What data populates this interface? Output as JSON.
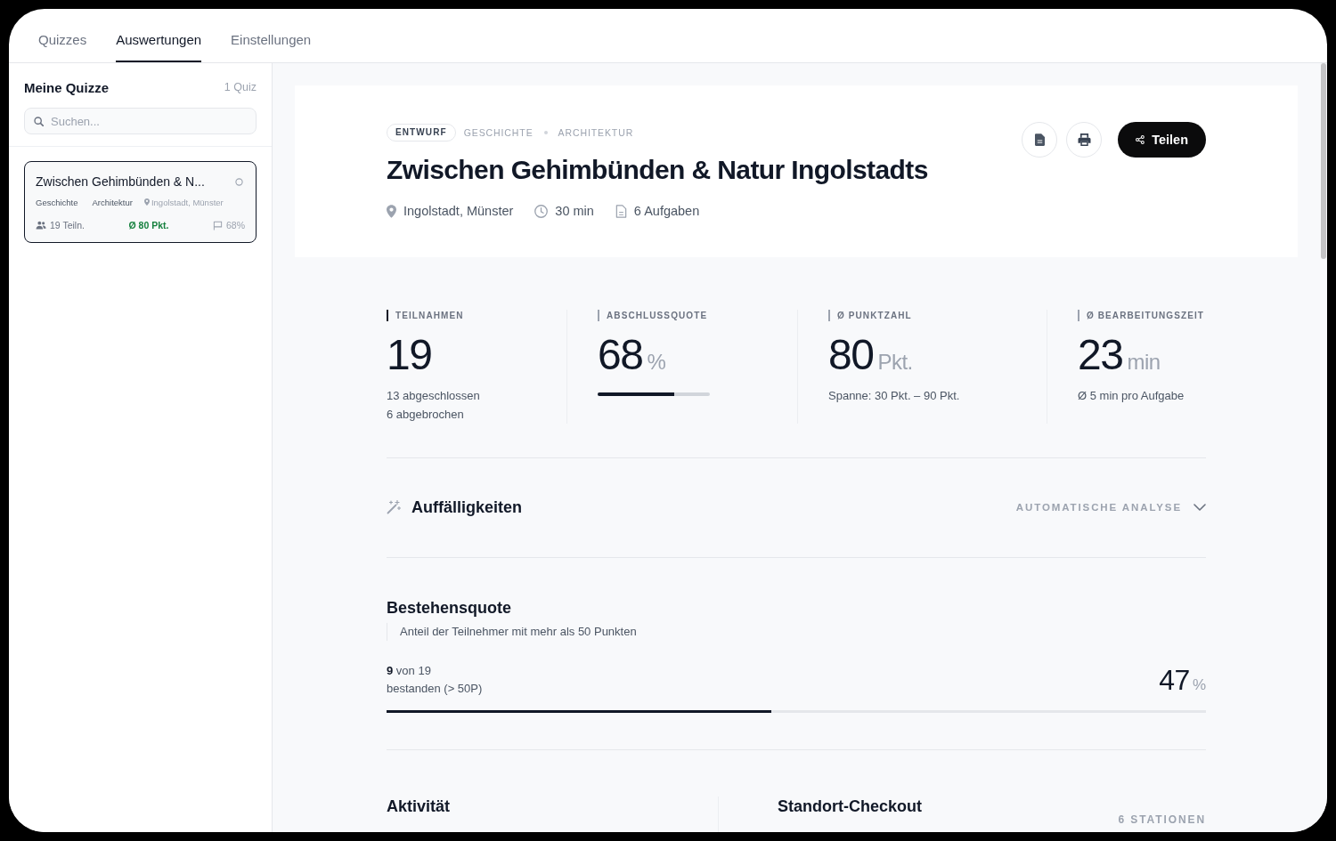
{
  "tabs": [
    {
      "label": "Quizzes",
      "selected": false
    },
    {
      "label": "Auswertungen",
      "selected": true
    },
    {
      "label": "Einstellungen",
      "selected": false
    }
  ],
  "sidebar": {
    "title": "Meine Quizze",
    "count": "1 Quiz",
    "search": {
      "placeholder": "Suchen..."
    },
    "quizzes": [
      {
        "title": "Zwischen Gehimbünden & N...",
        "selected": true,
        "tags": [
          "Geschichte",
          "Architektur"
        ],
        "location": "Ingolstadt, Münster",
        "participants": "19 Teiln.",
        "score": "Ø 80 Pkt.",
        "completion": "68%"
      }
    ]
  },
  "header": {
    "status": "ENTWURF",
    "categories": [
      "GESCHICHTE",
      "ARCHITEKTUR"
    ],
    "title": "Zwischen Gehimbünden & Natur Ingolstadts",
    "meta": [
      {
        "kind": "location",
        "text": "Ingolstadt, Münster"
      },
      {
        "kind": "duration",
        "text": "30 min"
      },
      {
        "kind": "tasks",
        "text": "6 Aufgaben"
      }
    ],
    "share_button": "Teilen"
  },
  "stats": [
    {
      "label": "TEILNAHMEN",
      "highlighted": true,
      "value": "19",
      "notes": [
        "13 abgeschlossen",
        "6 abgebrochen"
      ]
    },
    {
      "label": "ABSCHLUSSQUOTE",
      "highlighted": false,
      "value": "68",
      "unit": "%",
      "level": 0.68
    },
    {
      "label": "Ø PUNKTZAHL",
      "highlighted": false,
      "value": "80",
      "unit": "Pkt.",
      "notes": [
        "Spanne: 30 Pkt. – 90 Pkt."
      ]
    },
    {
      "label": "Ø BEARBEITUNGSZEIT",
      "highlighted": false,
      "value": "23",
      "unit": "min",
      "notes": [
        "Ø 5 min pro Aufgabe"
      ]
    }
  ],
  "insights": {
    "title": "Auffälligkeiten",
    "toggle": "AUTOMATISCHE ANALYSE",
    "expanded": false
  },
  "pass_rate": {
    "title": "Bestehensquote",
    "description": "Anteil der Teilnehmer mit mehr als 50 Punkten",
    "count": "**9** von 19",
    "caption": "bestanden (> 50P)",
    "value": "47",
    "unit": "%",
    "level": 0.47
  },
  "activity": {
    "title": "Aktivität"
  },
  "location_checkout": {
    "title": "Standort-Checkout",
    "count": "6 STATIONEN"
  }
}
